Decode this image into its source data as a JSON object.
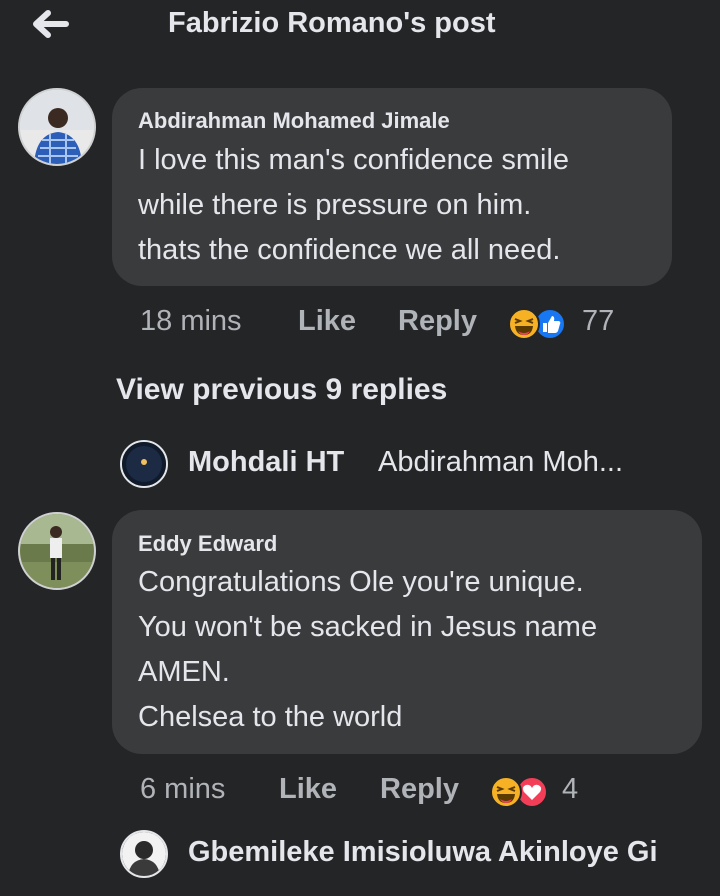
{
  "header": {
    "title": "Fabrizio Romano's post",
    "back_icon": "arrow-left-icon"
  },
  "comments": [
    {
      "author": "Abdirahman Mohamed Jimale",
      "lines": [
        "I love this man's confidence smile",
        "while there is pressure on him.",
        "thats the confidence we all need."
      ],
      "time": "18 mins",
      "like_label": "Like",
      "reply_label": "Reply",
      "reaction_icons": [
        "haha-icon",
        "like-icon"
      ],
      "reaction_count": "77"
    },
    {
      "author": "Eddy Edward",
      "lines": [
        "Congratulations Ole you're unique.",
        "You won't be sacked in Jesus name",
        "AMEN.",
        "Chelsea to the world"
      ],
      "time": "6 mins",
      "like_label": "Like",
      "reply_label": "Reply",
      "reaction_icons": [
        "haha-icon",
        "love-icon"
      ],
      "reaction_count": "4"
    }
  ],
  "view_previous": "View previous 9 replies",
  "reply_preview": {
    "name": "Mohdali HT",
    "text": "Abdirahman Moh..."
  },
  "next_comment": {
    "name": "Gbemileke Imisioluwa Akinloye Gi"
  },
  "colors": {
    "background": "#242526",
    "bubble": "#3a3b3c",
    "text": "#e4e6eb",
    "secondary_text": "#b0b3b8",
    "like_blue": "#1877f2",
    "love_red": "#f33e58",
    "haha_yellow": "#f7b125"
  }
}
